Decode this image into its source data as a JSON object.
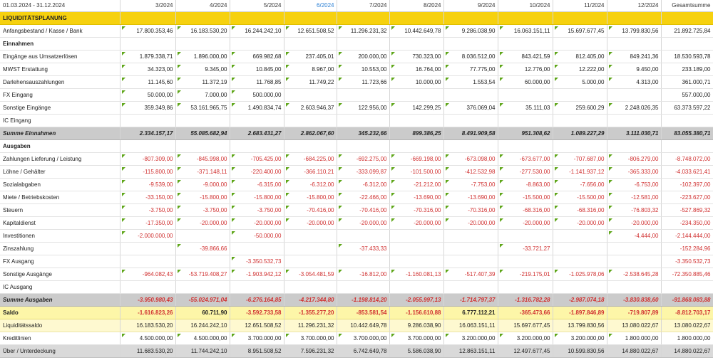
{
  "header": {
    "period": "01.03.2024 - 31.12.2024",
    "months": [
      "3/2024",
      "4/2024",
      "5/2024",
      "6/2024",
      "7/2024",
      "8/2024",
      "9/2024",
      "10/2024",
      "11/2024",
      "12/2024"
    ],
    "current_month_index": 3,
    "total_label": "Gesamtsumme"
  },
  "rows": [
    {
      "type": "title",
      "label": "LIQUIDITÄTSPLANUNG"
    },
    {
      "type": "data",
      "label": "Anfangsbestand / Kasse / Bank",
      "values": [
        "17.800.353,46",
        "16.183.530,20",
        "16.244.242,10",
        "12.651.508,52",
        "11.296.231,32",
        "10.442.649,78",
        "9.286.038,90",
        "16.063.151,11",
        "15.697.677,45",
        "13.799.830,56"
      ],
      "total": "21.892.725,84"
    },
    {
      "type": "section",
      "label": "Einnahmen"
    },
    {
      "type": "data",
      "label": "Eingänge aus Umsatzerlösen",
      "values": [
        "1.879.338,71",
        "1.896.000,00",
        "669.982,68",
        "237.405,01",
        "200.000,00",
        "730.323,00",
        "8.036.512,00",
        "843.421,59",
        "812.405,00",
        "849.241,36"
      ],
      "total": "18.530.593,78"
    },
    {
      "type": "data",
      "label": "MWST Erstattung",
      "values": [
        "34.323,00",
        "9.345,00",
        "10.845,00",
        "8.967,00",
        "10.553,00",
        "16.764,00",
        "77.775,00",
        "12.776,00",
        "12.222,00",
        "9.450,00"
      ],
      "total": "233.189,00"
    },
    {
      "type": "data",
      "label": "Darlehensauszahlungen",
      "values": [
        "11.145,60",
        "11.372,19",
        "11.768,85",
        "11.749,22",
        "11.723,66",
        "10.000,00",
        "1.553,54",
        "60.000,00",
        "5.000,00",
        "4.313,00"
      ],
      "total": "361.000,71"
    },
    {
      "type": "data",
      "label": "FX Eingang",
      "values": [
        "50.000,00",
        "7.000,00",
        "500.000,00",
        "",
        "",
        "",
        "",
        "",
        "",
        ""
      ],
      "total": "557.000,00"
    },
    {
      "type": "data",
      "label": "Sonstige Eingänge",
      "values": [
        "359.349,86",
        "53.161.965,75",
        "1.490.834,74",
        "2.603.946,37",
        "122.956,00",
        "142.299,25",
        "376.069,04",
        "35.111,03",
        "259.600,29",
        "2.248.026,35"
      ],
      "total": "63.373.597,22"
    },
    {
      "type": "data",
      "label": "IC Eingang",
      "values": [
        "",
        "",
        "",
        "",
        "",
        "",
        "",
        "",
        "",
        ""
      ],
      "total": ""
    },
    {
      "type": "sum",
      "label": "Summe Einnahmen",
      "values": [
        "2.334.157,17",
        "55.085.682,94",
        "2.683.431,27",
        "2.862.067,60",
        "345.232,66",
        "899.386,25",
        "8.491.909,58",
        "951.308,62",
        "1.089.227,29",
        "3.111.030,71"
      ],
      "total": "83.055.380,71"
    },
    {
      "type": "section",
      "label": "Ausgaben"
    },
    {
      "type": "data",
      "neg": true,
      "label": "Zahlungen Lieferung / Leistung",
      "values": [
        "-807.309,00",
        "-845.998,00",
        "-705.425,00",
        "-684.225,00",
        "-692.275,00",
        "-669.198,00",
        "-673.098,00",
        "-673.677,00",
        "-707.687,00",
        "-806.279,00"
      ],
      "total": "-8.748.072,00"
    },
    {
      "type": "data",
      "neg": true,
      "label": "Löhne / Gehälter",
      "values": [
        "-115.800,00",
        "-371.148,11",
        "-220.400,00",
        "-366.110,21",
        "-333.099,87",
        "-101.500,00",
        "-412.532,98",
        "-277.530,00",
        "-1.141.937,12",
        "-365.333,00"
      ],
      "total": "-4.033.621,41"
    },
    {
      "type": "data",
      "neg": true,
      "label": "Sozialabgaben",
      "values": [
        "-9.539,00",
        "-9.000,00",
        "-6.315,00",
        "-6.312,00",
        "-6.312,00",
        "-21.212,00",
        "-7.753,00",
        "-8.863,00",
        "-7.656,00",
        "-6.753,00"
      ],
      "total": "-102.397,00"
    },
    {
      "type": "data",
      "neg": true,
      "label": "Miete / Betriebskosten",
      "values": [
        "-33.150,00",
        "-15.800,00",
        "-15.800,00",
        "-15.800,00",
        "-22.466,00",
        "-13.690,00",
        "-13.690,00",
        "-15.500,00",
        "-15.500,00",
        "-12.581,00"
      ],
      "total": "-223.627,00"
    },
    {
      "type": "data",
      "neg": true,
      "label": "Steuern",
      "values": [
        "-3.750,00",
        "-3.750,00",
        "-3.750,00",
        "-70.416,00",
        "-70.416,00",
        "-70.316,00",
        "-70.316,00",
        "-68.316,00",
        "-68.316,00",
        "-76.803,32"
      ],
      "total": "-527.869,32"
    },
    {
      "type": "data",
      "neg": true,
      "label": "Kapitaldienst",
      "values": [
        "-17.350,00",
        "-20.000,00",
        "-20.000,00",
        "-20.000,00",
        "-20.000,00",
        "-20.000,00",
        "-20.000,00",
        "-20.000,00",
        "-20.000,00",
        "-20.000,00"
      ],
      "total": "-234.350,00"
    },
    {
      "type": "data",
      "neg": true,
      "label": "Investitionen",
      "values": [
        "-2.000.000,00",
        "",
        "-50.000,00",
        "",
        "",
        "",
        "",
        "",
        "",
        "-4.444,00"
      ],
      "total": "-2.144.444,00"
    },
    {
      "type": "data",
      "neg": true,
      "label": "Zinszahlung",
      "values": [
        "",
        "-39.866,66",
        "",
        "",
        "-37.433,33",
        "",
        "",
        "-33.721,27",
        "",
        ""
      ],
      "total": "-152.284,96"
    },
    {
      "type": "data",
      "neg": true,
      "label": "FX Ausgang",
      "values": [
        "",
        "",
        "-3.350.532,73",
        "",
        "",
        "",
        "",
        "",
        "",
        ""
      ],
      "total": "-3.350.532,73"
    },
    {
      "type": "data",
      "neg": true,
      "label": "Sonstige Ausgänge",
      "values": [
        "-964.082,43",
        "-53.719.408,27",
        "-1.903.942,12",
        "-3.054.481,59",
        "-16.812,00",
        "-1.160.081,13",
        "-517.407,39",
        "-219.175,01",
        "-1.025.978,06",
        "-2.538.645,28"
      ],
      "total": "-72.350.885,46"
    },
    {
      "type": "data",
      "label": "IC Ausgang",
      "values": [
        "",
        "",
        "",
        "",
        "",
        "",
        "",
        "",
        "",
        ""
      ],
      "total": ""
    },
    {
      "type": "sum",
      "neg": true,
      "label": "Summe Ausgaben",
      "values": [
        "-3.950.980,43",
        "-55.024.971,04",
        "-6.276.164,85",
        "-4.217.344,80",
        "-1.198.814,20",
        "-2.055.997,13",
        "-1.714.797,37",
        "-1.316.782,28",
        "-2.987.074,18",
        "-3.830.838,60"
      ],
      "total": "-91.868.083,88"
    },
    {
      "type": "saldo",
      "label": "Saldo",
      "values": [
        "-1.616.823,26",
        "60.711,90",
        "-3.592.733,58",
        "-1.355.277,20",
        "-853.581,54",
        "-1.156.610,88",
        "6.777.112,21",
        "-365.473,66",
        "-1.897.846,89",
        "-719.807,89"
      ],
      "total": "-8.812.703,17"
    },
    {
      "type": "lyellow",
      "label": "Liquiditätssaldo",
      "values": [
        "16.183.530,20",
        "16.244.242,10",
        "12.651.508,52",
        "11.296.231,32",
        "10.442.649,78",
        "9.286.038,90",
        "16.063.151,11",
        "15.697.677,45",
        "13.799.830,56",
        "13.080.022,67"
      ],
      "total": "13.080.022,67"
    },
    {
      "type": "data",
      "label": "Kreditlinien",
      "values": [
        "4.500.000,00",
        "4.500.000,00",
        "3.700.000,00",
        "3.700.000,00",
        "3.700.000,00",
        "3.700.000,00",
        "3.200.000,00",
        "3.200.000,00",
        "3.200.000,00",
        "1.800.000,00"
      ],
      "total": "1.800.000,00"
    },
    {
      "type": "grey",
      "label": "Über / Unterdeckung",
      "values": [
        "11.683.530,20",
        "11.744.242,10",
        "8.951.508,52",
        "7.596.231,32",
        "6.742.649,78",
        "5.586.038,90",
        "12.863.151,11",
        "12.497.677,45",
        "10.599.830,56",
        "14.880.022,67"
      ],
      "total": "14.880.022,67"
    }
  ]
}
